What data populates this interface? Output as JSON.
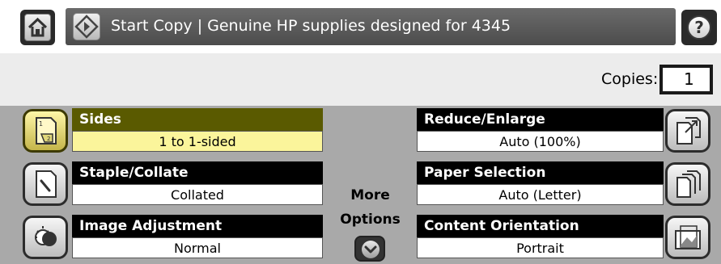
{
  "header": {
    "title": "Start Copy | Genuine HP supplies designed for 4345",
    "help_glyph": "?"
  },
  "copies": {
    "label": "Copies:",
    "value": "1"
  },
  "options": {
    "sides": {
      "label": "Sides",
      "value": "1 to 1-sided",
      "icon": "sides-icon",
      "selected": true
    },
    "staple": {
      "label": "Staple/Collate",
      "value": "Collated",
      "icon": "staple-icon"
    },
    "image": {
      "label": "Image Adjustment",
      "value": "Normal",
      "icon": "image-adjust-icon"
    },
    "reduce": {
      "label": "Reduce/Enlarge",
      "value": "Auto (100%)",
      "icon": "reduce-enlarge-icon"
    },
    "paper": {
      "label": "Paper Selection",
      "value": "Auto (Letter)",
      "icon": "paper-selection-icon"
    },
    "orientation": {
      "label": "Content Orientation",
      "value": "Portrait",
      "icon": "content-orientation-icon"
    }
  },
  "more_options": {
    "line1": "More",
    "line2": "Options"
  },
  "colors": {
    "selected_header": "#5a5a00",
    "selected_value": "#fbf59b",
    "panel_bg": "#a9a9a9"
  }
}
